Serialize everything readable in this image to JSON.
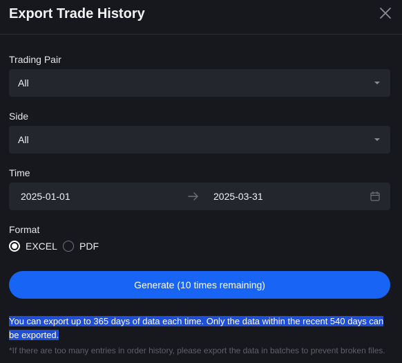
{
  "header": {
    "title": "Export Trade History"
  },
  "trading_pair": {
    "label": "Trading Pair",
    "value": "All"
  },
  "side": {
    "label": "Side",
    "value": "All"
  },
  "time": {
    "label": "Time",
    "start": "2025-01-01",
    "end": "2025-03-31"
  },
  "format": {
    "label": "Format",
    "options": [
      {
        "label": "EXCEL",
        "selected": true
      },
      {
        "label": "PDF",
        "selected": false
      }
    ]
  },
  "generate_button": {
    "label": "Generate (10 times remaining)"
  },
  "notice": "You can export up to 365 days of data each time. Only the data within the recent 540 days can be exported.",
  "footnote": "*If there are too many entries in order history, please export the data in batches to prevent broken files.",
  "colors": {
    "accent": "#1764f5",
    "background": "#17181d",
    "field": "#24262d",
    "highlight": "#1f4fd8"
  },
  "icons": {
    "close": "close-icon",
    "caret": "chevron-down-icon",
    "arrow": "arrow-right-icon",
    "calendar": "calendar-icon"
  }
}
